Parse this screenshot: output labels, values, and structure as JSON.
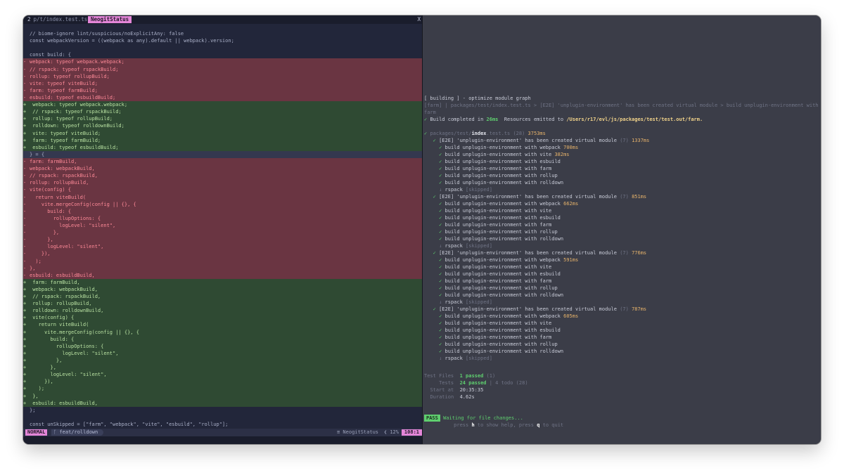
{
  "editor": {
    "tab_number": "2",
    "tab_file": "p/t/index.test.ts",
    "tab_active": "NeogitStatus",
    "tab_close": "X",
    "lines": [
      {
        "kind": "ctx",
        "sign": "",
        "text": "// biome-ignore lint/suspicious/noExplicitAny: false"
      },
      {
        "kind": "ctx",
        "sign": "",
        "text": "const webpackVersion = ((webpack as any).default || webpack).version;"
      },
      {
        "kind": "ctx",
        "sign": "",
        "text": ""
      },
      {
        "kind": "ctx",
        "sign": "",
        "text": "const build: {"
      },
      {
        "kind": "del",
        "sign": "-",
        "text": "webpack: typeof webpack.webpack;"
      },
      {
        "kind": "del",
        "sign": "-",
        "text": "// rspack: typeof rspackBuild;"
      },
      {
        "kind": "del",
        "sign": "-",
        "text": "rollup: typeof rollupBuild;"
      },
      {
        "kind": "del",
        "sign": "-",
        "text": "vite: typeof viteBuild;"
      },
      {
        "kind": "del",
        "sign": "-",
        "text": "farm: typeof farmBuild;"
      },
      {
        "kind": "del",
        "sign": "-",
        "text": "esbuild: typeof esbuildBuild;"
      },
      {
        "kind": "add",
        "sign": "+",
        "text": " webpack: typeof webpack.webpack;"
      },
      {
        "kind": "add",
        "sign": "+",
        "text": " // rspack: typeof rspackBuild;"
      },
      {
        "kind": "add",
        "sign": "+",
        "text": " rollup: typeof rollupBuild;"
      },
      {
        "kind": "add",
        "sign": "+",
        "text": " rolldown: typeof rolldownBuild;"
      },
      {
        "kind": "add",
        "sign": "+",
        "text": " vite: typeof viteBuild;"
      },
      {
        "kind": "add",
        "sign": "+",
        "text": " farm: typeof farmBuild;"
      },
      {
        "kind": "add",
        "sign": "+",
        "text": " esbuild: typeof esbuildBuild;"
      },
      {
        "kind": "fold",
        "sign": "",
        "text": "} = {"
      },
      {
        "kind": "del",
        "sign": "-",
        "text": "farm: farmBuild,"
      },
      {
        "kind": "del",
        "sign": "-",
        "text": "webpack: webpackBuild,"
      },
      {
        "kind": "del",
        "sign": "-",
        "text": "// rspack: rspackBuild,"
      },
      {
        "kind": "del",
        "sign": "-",
        "text": "rollup: rollupBuild,"
      },
      {
        "kind": "del",
        "sign": "-",
        "text": "vite(config) {"
      },
      {
        "kind": "del",
        "sign": "-",
        "text": "  return viteBuild("
      },
      {
        "kind": "del",
        "sign": "-",
        "text": "    vite.mergeConfig(config || {}, {"
      },
      {
        "kind": "del",
        "sign": "-",
        "text": "      build: {"
      },
      {
        "kind": "del",
        "sign": "-",
        "text": "        rollupOptions: {"
      },
      {
        "kind": "del",
        "sign": "-",
        "text": "          logLevel: \"silent\","
      },
      {
        "kind": "del",
        "sign": "-",
        "text": "        },"
      },
      {
        "kind": "del",
        "sign": "-",
        "text": "      },"
      },
      {
        "kind": "del",
        "sign": "-",
        "text": "      logLevel: \"silent\","
      },
      {
        "kind": "del",
        "sign": "-",
        "text": "    }),"
      },
      {
        "kind": "del",
        "sign": "-",
        "text": "  );"
      },
      {
        "kind": "del",
        "sign": "-",
        "text": "},"
      },
      {
        "kind": "del",
        "sign": "-",
        "text": "esbuild: esbuildBuild,"
      },
      {
        "kind": "add",
        "sign": "+",
        "text": " farm: farmBuild,"
      },
      {
        "kind": "add",
        "sign": "+",
        "text": " webpack: webpackBuild,"
      },
      {
        "kind": "add",
        "sign": "+",
        "text": " // rspack: rspackBuild,"
      },
      {
        "kind": "add",
        "sign": "+",
        "text": " rollup: rollupBuild,"
      },
      {
        "kind": "add",
        "sign": "+",
        "text": " rolldown: rolldownBuild,"
      },
      {
        "kind": "add",
        "sign": "+",
        "text": " vite(config) {"
      },
      {
        "kind": "add",
        "sign": "+",
        "text": "   return viteBuild("
      },
      {
        "kind": "add",
        "sign": "+",
        "text": "     vite.mergeConfig(config || {}, {"
      },
      {
        "kind": "add",
        "sign": "+",
        "text": "       build: {"
      },
      {
        "kind": "add",
        "sign": "+",
        "text": "         rollupOptions: {"
      },
      {
        "kind": "add",
        "sign": "+",
        "text": "           logLevel: \"silent\","
      },
      {
        "kind": "add",
        "sign": "+",
        "text": "         },"
      },
      {
        "kind": "add",
        "sign": "+",
        "text": "       },"
      },
      {
        "kind": "add",
        "sign": "+",
        "text": "       logLevel: \"silent\","
      },
      {
        "kind": "add",
        "sign": "+",
        "text": "     }),"
      },
      {
        "kind": "add",
        "sign": "+",
        "text": "   );"
      },
      {
        "kind": "add",
        "sign": "+",
        "text": " },"
      },
      {
        "kind": "add",
        "sign": "+",
        "text": " esbuild: esbuildBuild,"
      },
      {
        "kind": "ctx",
        "sign": "",
        "text": "};"
      },
      {
        "kind": "ctx",
        "sign": "",
        "text": ""
      },
      {
        "kind": "ctx",
        "sign": "",
        "text": "const unSkipped = [\"farm\", \"webpack\", \"vite\", \"esbuild\", \"rollup\"];"
      }
    ],
    "status": {
      "mode": "NORMAL",
      "branch": "feat/rolldown",
      "filetype": "NeogitStatus",
      "percent": "12%",
      "position": "108:1"
    }
  },
  "terminal": {
    "building_line": "[ building ] - optimize module graph",
    "farm_log_line": "[farm] | packages/test/index.test.ts > [E2E] 'unplugin-environment' has been created virtual module > build unplugin-environment with",
    "farm_log_cont": "farm",
    "complete_label": "Build completed in",
    "complete_time": "26ms",
    "complete_mid": "Resources emitted to",
    "complete_path": "/Users/r17/evl/js/packages/test/test.out/farm.",
    "file_prefix": "packages/test/",
    "file_name": "index",
    "file_ext": ".test.ts",
    "file_count": "(28)",
    "file_time": "3753ms",
    "suites": [
      {
        "title": "[E2E] 'unplugin-environment' has been created virtual module",
        "count": "(7)",
        "time": "1337ms",
        "tests": [
          {
            "name": "build unplugin-environment with webpack",
            "time": "700ms"
          },
          {
            "name": "build unplugin-environment with vite",
            "time": "382ms"
          },
          {
            "name": "build unplugin-environment with esbuild",
            "time": ""
          },
          {
            "name": "build unplugin-environment with farm",
            "time": ""
          },
          {
            "name": "build unplugin-environment with rollup",
            "time": ""
          },
          {
            "name": "build unplugin-environment with rolldown",
            "time": ""
          }
        ],
        "skipped_name": "rspack",
        "skipped_tag": "[skipped]"
      },
      {
        "title": "[E2E] 'unplugin-environment' has been created virtual module",
        "count": "(7)",
        "time": "851ms",
        "tests": [
          {
            "name": "build unplugin-environment with webpack",
            "time": "662ms"
          },
          {
            "name": "build unplugin-environment with vite",
            "time": ""
          },
          {
            "name": "build unplugin-environment with esbuild",
            "time": ""
          },
          {
            "name": "build unplugin-environment with farm",
            "time": ""
          },
          {
            "name": "build unplugin-environment with rollup",
            "time": ""
          },
          {
            "name": "build unplugin-environment with rolldown",
            "time": ""
          }
        ],
        "skipped_name": "rspack",
        "skipped_tag": "[skipped]"
      },
      {
        "title": "[E2E] 'unplugin-environment' has been created virtual module",
        "count": "(7)",
        "time": "776ms",
        "tests": [
          {
            "name": "build unplugin-environment with webpack",
            "time": "591ms"
          },
          {
            "name": "build unplugin-environment with vite",
            "time": ""
          },
          {
            "name": "build unplugin-environment with esbuild",
            "time": ""
          },
          {
            "name": "build unplugin-environment with farm",
            "time": ""
          },
          {
            "name": "build unplugin-environment with rollup",
            "time": ""
          },
          {
            "name": "build unplugin-environment with rolldown",
            "time": ""
          }
        ],
        "skipped_name": "rspack",
        "skipped_tag": "[skipped]"
      },
      {
        "title": "[E2E] 'unplugin-environment' has been created virtual module",
        "count": "(7)",
        "time": "787ms",
        "tests": [
          {
            "name": "build unplugin-environment with webpack",
            "time": "605ms"
          },
          {
            "name": "build unplugin-environment with vite",
            "time": ""
          },
          {
            "name": "build unplugin-environment with esbuild",
            "time": ""
          },
          {
            "name": "build unplugin-environment with farm",
            "time": ""
          },
          {
            "name": "build unplugin-environment with rollup",
            "time": ""
          },
          {
            "name": "build unplugin-environment with rolldown",
            "time": ""
          }
        ],
        "skipped_name": "rspack",
        "skipped_tag": "[skipped]"
      }
    ],
    "summary": {
      "files_label": "Test Files",
      "files_value": "1 passed",
      "files_count": "(1)",
      "tests_label": "Tests",
      "tests_value": "24 passed",
      "tests_todo": "| 4 todo (28)",
      "start_label": "Start at",
      "start_value": "20:35:35",
      "duration_label": "Duration",
      "duration_value": "4.62s"
    },
    "pass_badge": "PASS",
    "waiting": "Waiting for file changes...",
    "help_1": "press",
    "help_h": "h",
    "help_2": "to show help, press",
    "help_q": "q",
    "help_3": "to quit"
  },
  "colors": {
    "editor_bg": "#22263a",
    "terminal_bg": "#3b3d48",
    "diff_del_bg": "#6a3542",
    "diff_add_bg": "#2f4a33",
    "accent_pink": "#e486d8",
    "pass_green": "#5fcf6f"
  }
}
